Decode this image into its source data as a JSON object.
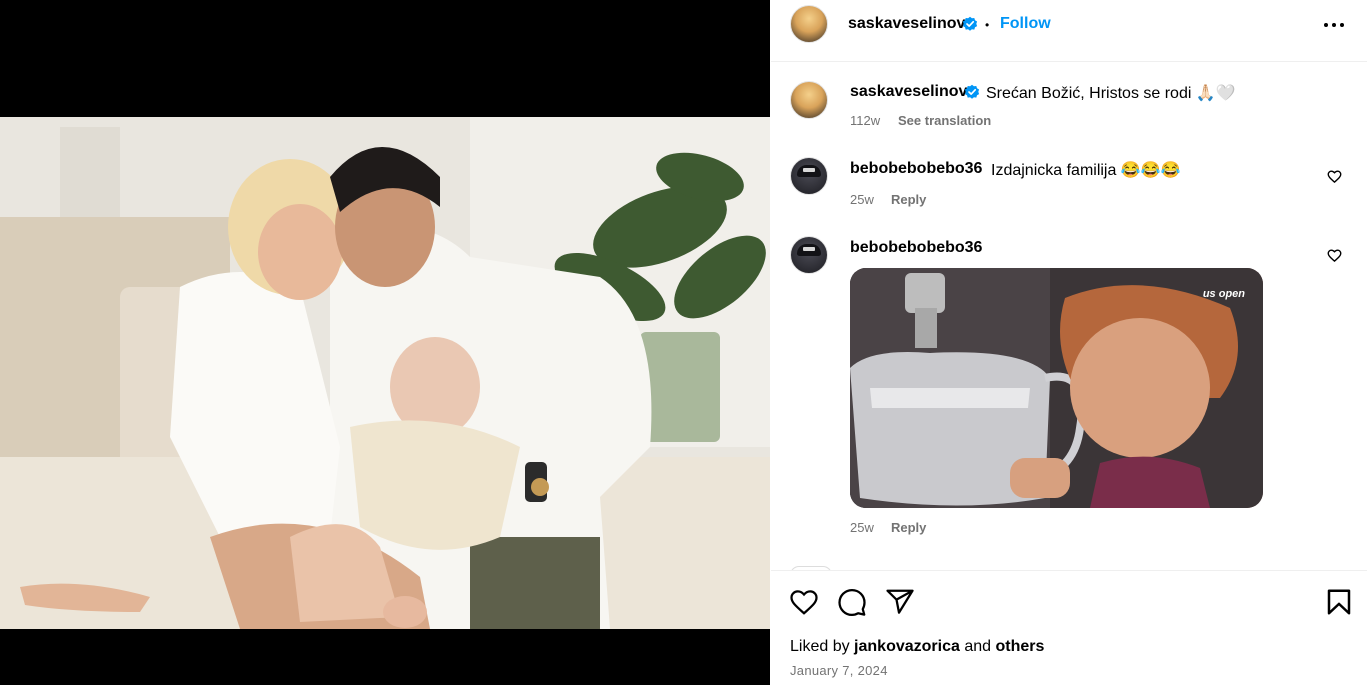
{
  "post": {
    "author": "saskaveselinov",
    "follow_label": "Follow",
    "separator": "•",
    "caption": "Srećan Božić, Hristos se rodi 🙏🏻🤍",
    "caption_age": "112w",
    "see_translation": "See translation"
  },
  "comments": [
    {
      "user": "bebobebobebo36",
      "text": "Izdajnicka familija 😂😂😂",
      "age": "25w",
      "reply": "Reply"
    },
    {
      "user": "bebobebobebo36",
      "text": "",
      "age": "25w",
      "reply": "Reply",
      "gif_brand": "us open"
    }
  ],
  "footer": {
    "liked_prefix": "Liked by",
    "liked_user": "jankovazorica",
    "liked_and": "and",
    "liked_others": "others",
    "date": "January 7, 2024"
  },
  "icons": {
    "like": "heart-icon",
    "comment": "comment-icon",
    "share": "share-icon",
    "save": "bookmark-icon",
    "more": "more-icon",
    "verified": "verified-badge-icon"
  },
  "colors": {
    "accent": "#0095f6",
    "verified": "#0095f6",
    "muted": "#737373"
  }
}
